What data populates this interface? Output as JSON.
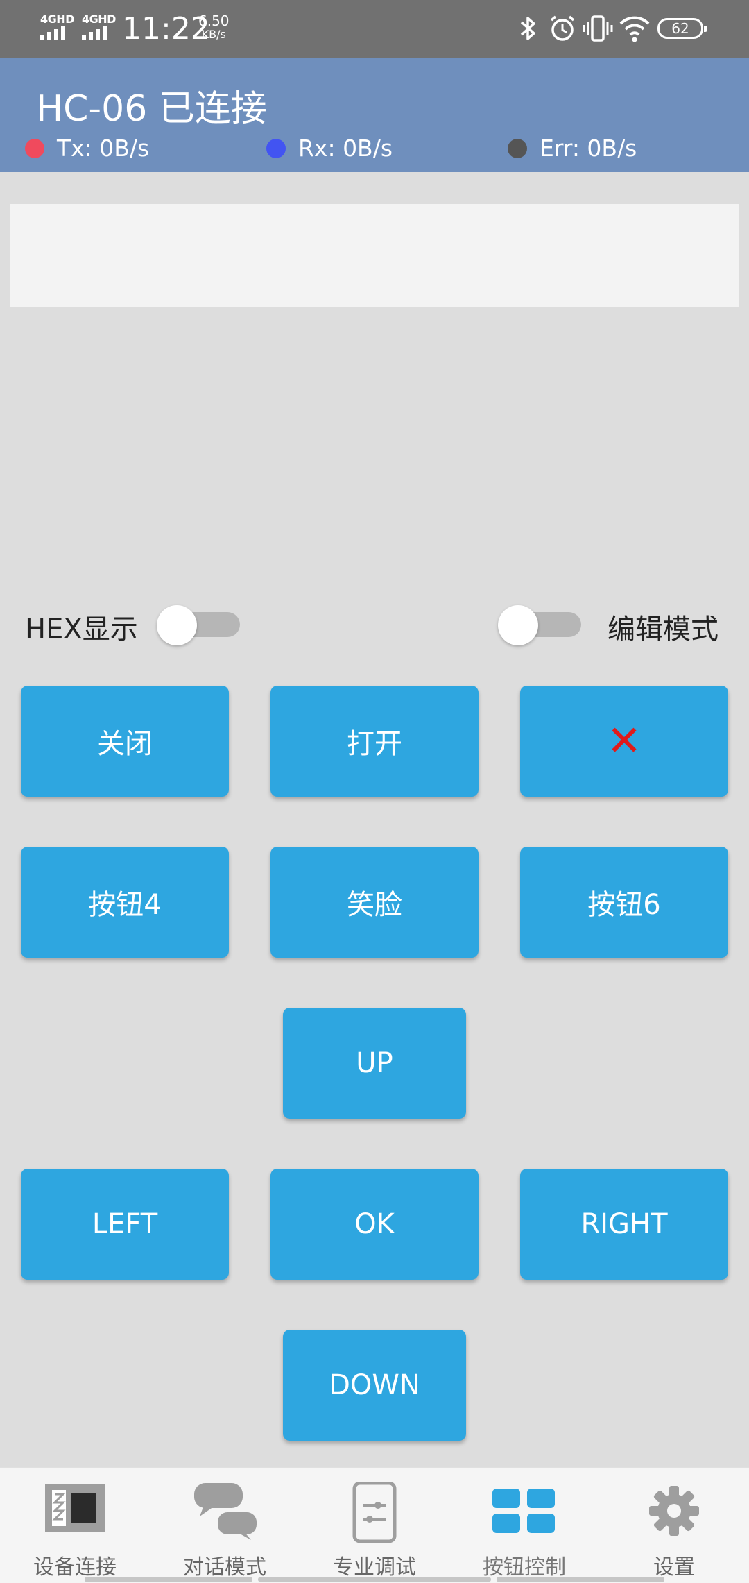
{
  "status_bar": {
    "sim1": "4GHD",
    "sim2": "4GHD",
    "time": "11:22",
    "speed_value": "6.50",
    "speed_unit": "KB/s",
    "battery": "62",
    "icons": [
      "bluetooth-icon",
      "alarm-icon",
      "vibrate-icon",
      "wifi-icon",
      "battery-icon"
    ]
  },
  "header": {
    "title": "HC-06 已连接",
    "tx": "Tx: 0B/s",
    "rx": "Rx: 0B/s",
    "err": "Err: 0B/s",
    "colors": {
      "tx": "#f04a5d",
      "rx": "#4254f2",
      "err": "#555555",
      "background": "#6f8fbd"
    }
  },
  "toggles": {
    "hex_label": "HEX显示",
    "edit_label": "编辑模式"
  },
  "buttons": {
    "close": "关闭",
    "open": "打开",
    "cancel_icon": "close-icon",
    "btn4": "按钮4",
    "smile": "笑脸",
    "btn6": "按钮6",
    "up": "UP",
    "left": "LEFT",
    "ok": "OK",
    "right": "RIGHT",
    "down": "DOWN",
    "color": "#2ea6e0"
  },
  "bottom_nav": {
    "items": [
      {
        "label": "设备连接",
        "icon": "device-icon"
      },
      {
        "label": "对话模式",
        "icon": "chat-icon"
      },
      {
        "label": "专业调试",
        "icon": "slider-icon"
      },
      {
        "label": "按钮控制",
        "icon": "grid-icon"
      },
      {
        "label": "设置",
        "icon": "gear-icon"
      }
    ],
    "active_color": "#2ea6e0"
  }
}
